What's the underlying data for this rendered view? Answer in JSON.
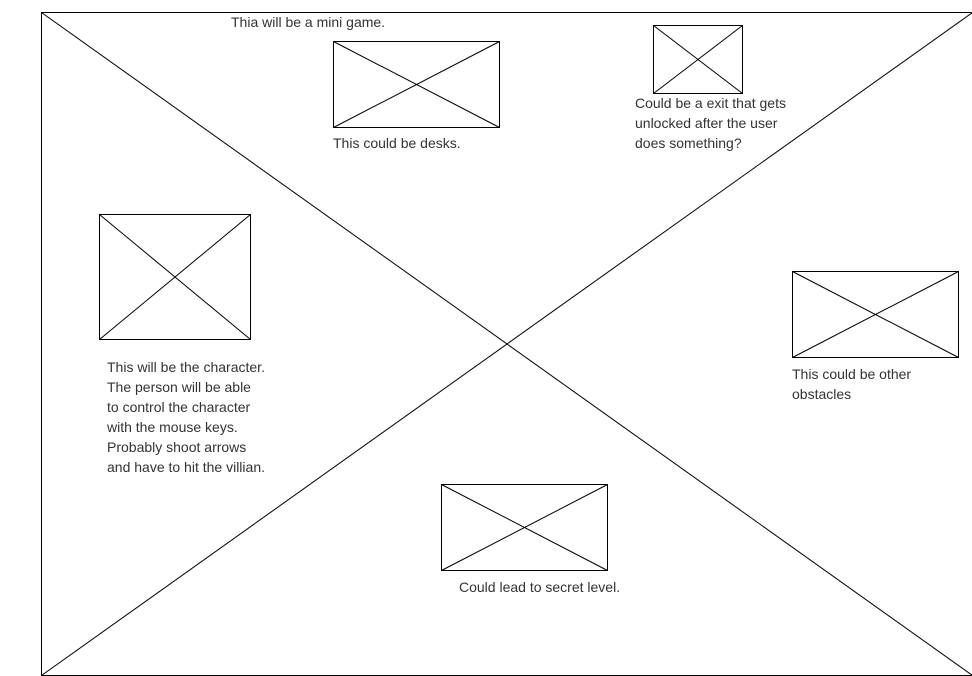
{
  "notes": {
    "title": "Thia will be a mini game.",
    "desks": "This could be desks.",
    "exit": "Could be a exit that gets\nunlocked after the user\ndoes something?",
    "character": "This will be the character.\n The person will be able\nto control the character\nwith the mouse keys.\nProbably shoot arrows\nand have to hit the villian.",
    "obstacles": "This could be other\nobstacles",
    "secret": "Could lead to secret level."
  },
  "colors": {
    "stroke": "#000000",
    "text": "#333333",
    "background": "#ffffff"
  }
}
